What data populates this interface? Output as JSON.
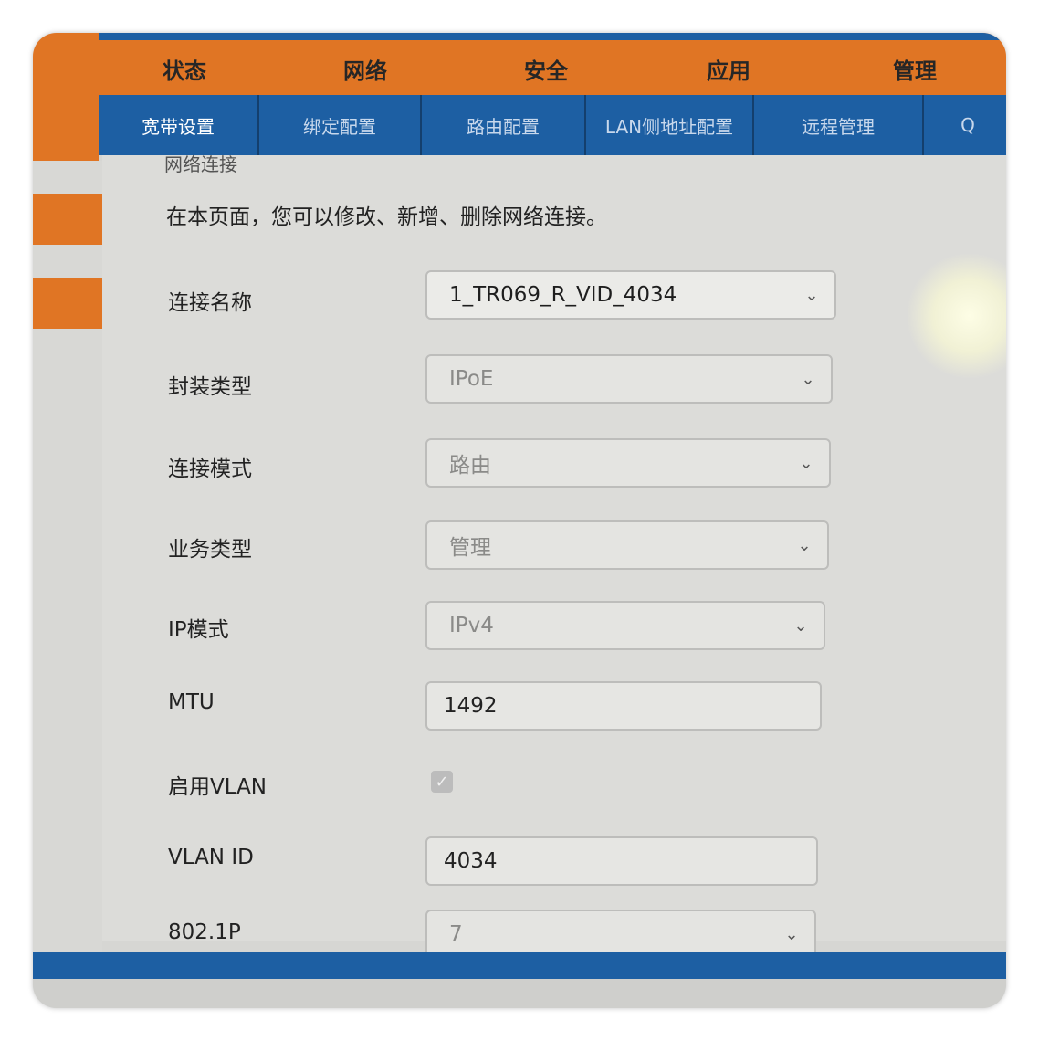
{
  "top_nav": {
    "items": [
      "状态",
      "网络",
      "安全",
      "应用",
      "管理"
    ]
  },
  "sub_nav": {
    "tabs": [
      "宽带设置",
      "绑定配置",
      "路由配置",
      "LAN侧地址配置",
      "远程管理",
      "Q"
    ],
    "active_index": 0
  },
  "page": {
    "section_title": "网络连接",
    "intro": "在本页面，您可以修改、新增、删除网络连接。"
  },
  "form": {
    "connection_name": {
      "label": "连接名称",
      "value": "1_TR069_R_VID_4034"
    },
    "encapsulation": {
      "label": "封装类型",
      "value": "IPoE"
    },
    "connection_mode": {
      "label": "连接模式",
      "value": "路由"
    },
    "service_type": {
      "label": "业务类型",
      "value": "管理"
    },
    "ip_mode": {
      "label": "IP模式",
      "value": "IPv4"
    },
    "mtu": {
      "label": "MTU",
      "value": "1492"
    },
    "enable_vlan": {
      "label": "启用VLAN",
      "checked": true
    },
    "vlan_id": {
      "label": "VLAN ID",
      "value": "4034"
    },
    "dot1p": {
      "label": "802.1P",
      "value": "7"
    }
  },
  "colors": {
    "nav_orange": "#e07524",
    "nav_blue": "#1d5fa3"
  }
}
